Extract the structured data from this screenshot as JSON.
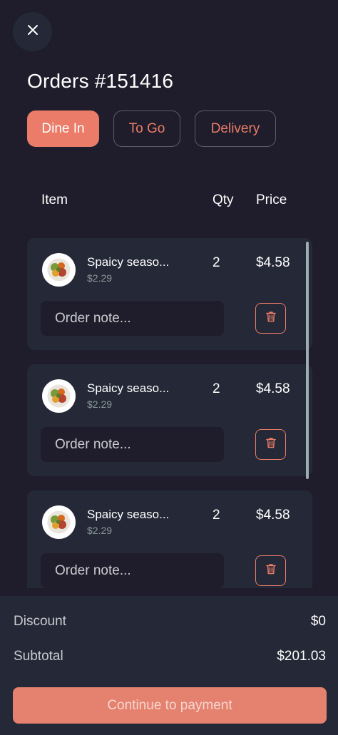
{
  "header": {
    "close_icon": "close-icon",
    "title": "Orders #151416"
  },
  "tabs": [
    {
      "label": "Dine In",
      "active": true
    },
    {
      "label": "To Go",
      "active": false
    },
    {
      "label": "Delivery",
      "active": false
    }
  ],
  "columns": {
    "item": "Item",
    "qty": "Qty",
    "price": "Price"
  },
  "items": [
    {
      "name": "Spaicy seaso...",
      "unit_price": "$2.29",
      "qty": "2",
      "total": "$4.58",
      "note_placeholder": "Order note...",
      "icon": "trash-icon"
    },
    {
      "name": "Spaicy seaso...",
      "unit_price": "$2.29",
      "qty": "2",
      "total": "$4.58",
      "note_placeholder": "Order note...",
      "icon": "trash-icon"
    },
    {
      "name": "Spaicy seaso...",
      "unit_price": "$2.29",
      "qty": "2",
      "total": "$4.58",
      "note_placeholder": "Order note...",
      "icon": "trash-icon"
    }
  ],
  "summary": {
    "discount_label": "Discount",
    "discount_value": "$0",
    "subtotal_label": "Subtotal",
    "subtotal_value": "$201.03"
  },
  "actions": {
    "continue_label": "Continue to payment"
  },
  "colors": {
    "background": "#1f1d2b",
    "card": "#252836",
    "accent": "#ea7c69",
    "muted_text": "#889898"
  }
}
